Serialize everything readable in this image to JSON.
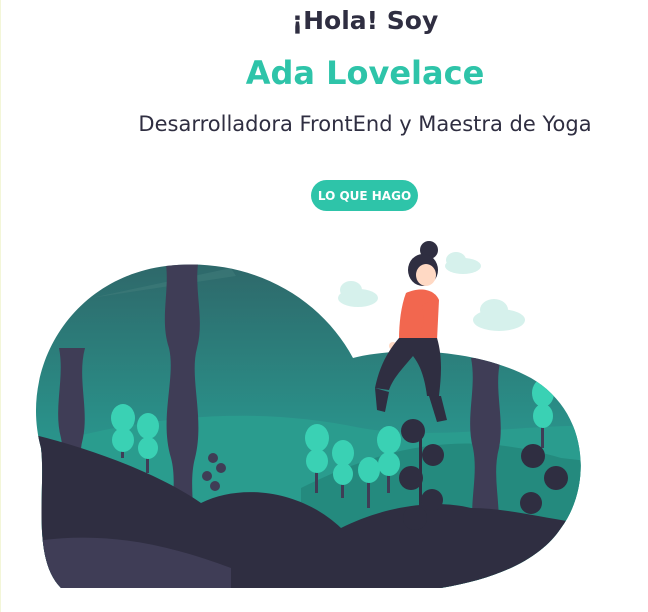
{
  "hero": {
    "greeting": "¡Hola! Soy",
    "name": "Ada Lovelace",
    "role": "Desarrolladora FrontEnd y Maestra de Yoga",
    "cta_label": "LO QUE HAGO"
  },
  "colors": {
    "accent": "#2ec4a9",
    "text": "#2f2e41",
    "shirt": "#f2674f"
  },
  "illustration": {
    "description_icon": "woman-sitting-on-hill-forest-icon"
  }
}
